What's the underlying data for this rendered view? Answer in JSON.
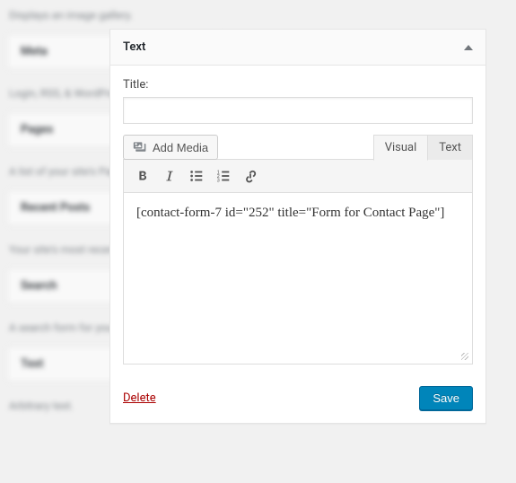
{
  "sidebar": {
    "items": [
      {
        "title": "",
        "desc": "Displays an image gallery."
      },
      {
        "title": "Meta",
        "desc": "Login, RSS, & WordPress.org links."
      },
      {
        "title": "Pages",
        "desc": "A list of your site's Pages."
      },
      {
        "title": "Recent Posts",
        "desc": "Your site's most recent Posts."
      },
      {
        "title": "Search",
        "desc": "A search form for your site."
      },
      {
        "title": "Text",
        "desc": "Arbitrary text."
      }
    ]
  },
  "widget": {
    "header": "Text",
    "title_label": "Title:",
    "title_value": "",
    "add_media": "Add Media",
    "tabs": {
      "visual": "Visual",
      "text": "Text"
    },
    "content": "[contact-form-7 id=\"252\" title=\"Form for Contact Page\"]",
    "footer": {
      "delete": "Delete",
      "save": "Save"
    }
  }
}
